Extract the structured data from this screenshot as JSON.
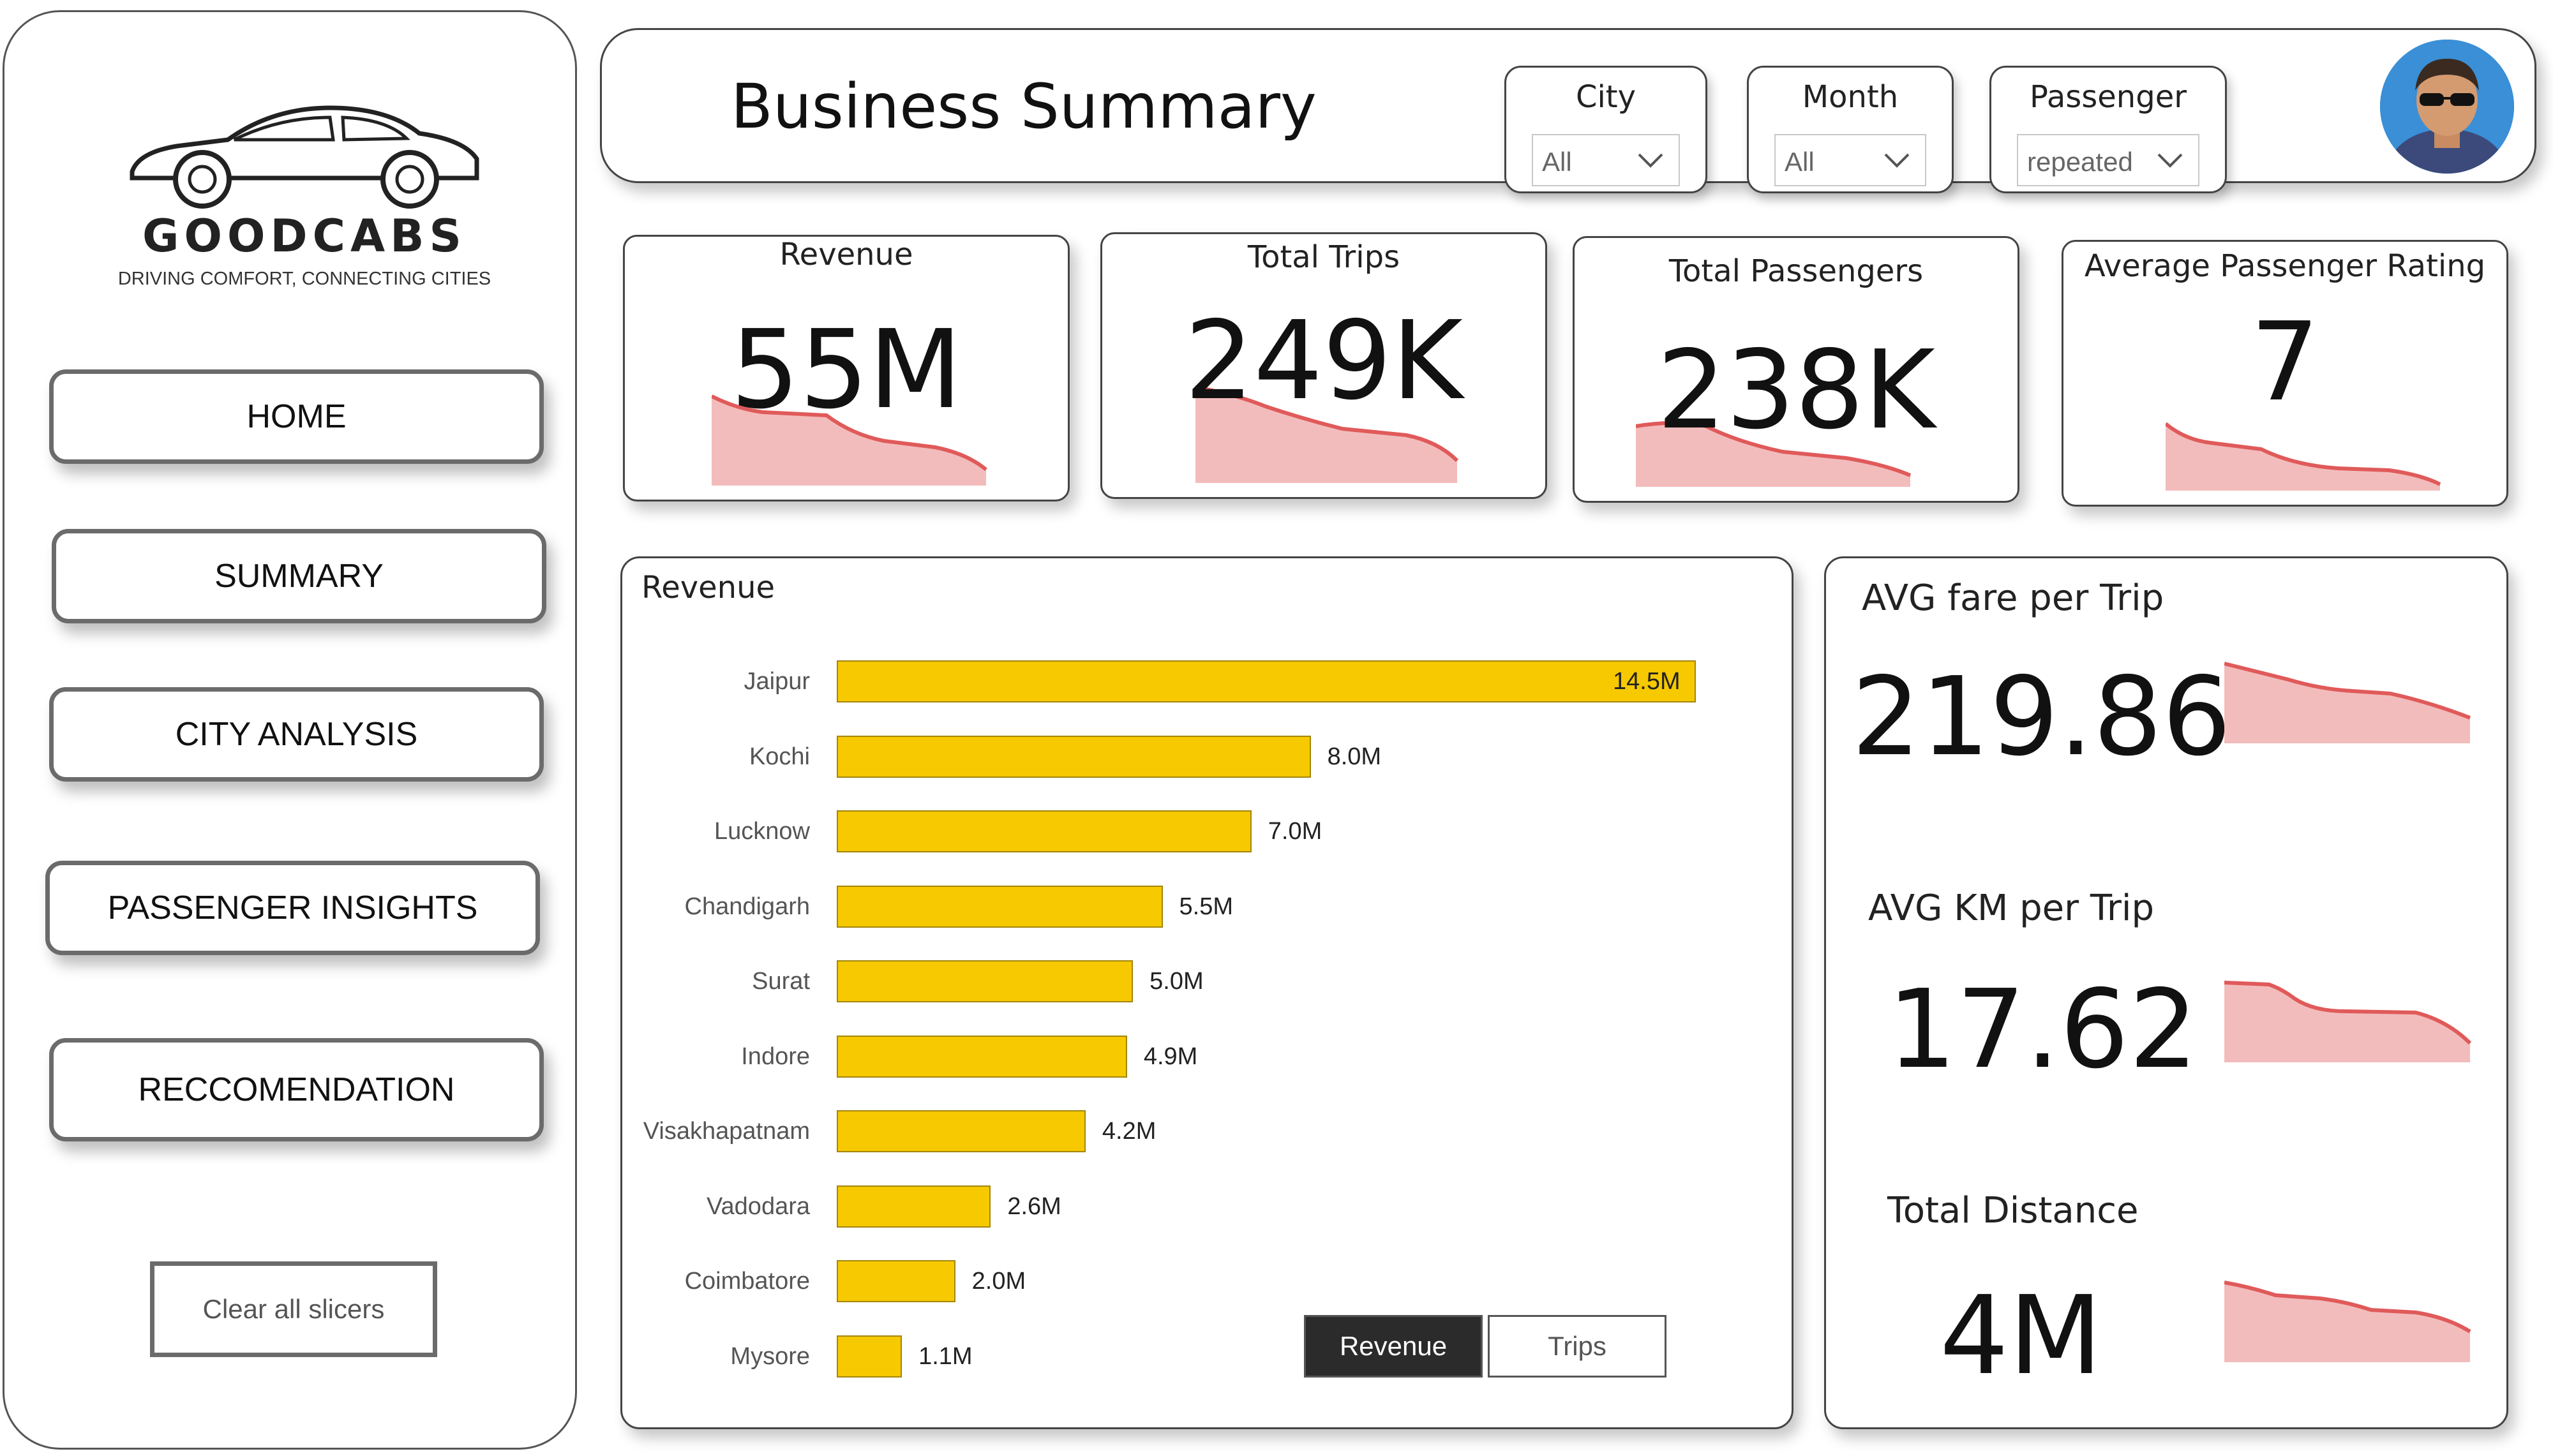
{
  "sidebar": {
    "brand": "GOODCABS",
    "tagline": "DRIVING COMFORT, CONNECTING CITIES",
    "nav": [
      {
        "label": "HOME"
      },
      {
        "label": "SUMMARY"
      },
      {
        "label": "CITY ANALYSIS"
      },
      {
        "label": "PASSENGER INSIGHTS"
      },
      {
        "label": "RECCOMENDATION"
      }
    ],
    "clear_label": "Clear all slicers"
  },
  "header": {
    "title": "Business Summary",
    "slicers": [
      {
        "label": "City",
        "value": "All"
      },
      {
        "label": "Month",
        "value": "All"
      },
      {
        "label": "Passenger",
        "value": "repeated"
      }
    ]
  },
  "kpis": [
    {
      "label": "Revenue",
      "value": "55M"
    },
    {
      "label": "Total Trips",
      "value": "249K"
    },
    {
      "label": "Total Passengers",
      "value": "238K"
    },
    {
      "label": "Average Passenger Rating",
      "value": "7"
    }
  ],
  "side_metrics": [
    {
      "label": "AVG fare per Trip",
      "value": "219.86"
    },
    {
      "label": "AVG KM per Trip",
      "value": "17.62"
    },
    {
      "label": "Total Distance",
      "value": "4M"
    }
  ],
  "chart_toggle": {
    "active": "Revenue",
    "inactive": "Trips"
  },
  "colors": {
    "bar": "#f6c900",
    "spark_line": "#e05a5a",
    "spark_fill": "#f3bcbc",
    "toggle_active": "#2b2b2b"
  },
  "chart_data": {
    "type": "bar",
    "orientation": "horizontal",
    "title": "Revenue",
    "categories": [
      "Jaipur",
      "Kochi",
      "Lucknow",
      "Chandigarh",
      "Surat",
      "Indore",
      "Visakhapatnam",
      "Vadodara",
      "Coimbatore",
      "Mysore"
    ],
    "values": [
      14.5,
      8.0,
      7.0,
      5.5,
      5.0,
      4.9,
      4.2,
      2.6,
      2.0,
      1.1
    ],
    "labels": [
      "14.5M",
      "8.0M",
      "7.0M",
      "5.5M",
      "5.0M",
      "4.9M",
      "4.2M",
      "2.6M",
      "2.0M",
      "1.1M"
    ],
    "unit": "M"
  }
}
